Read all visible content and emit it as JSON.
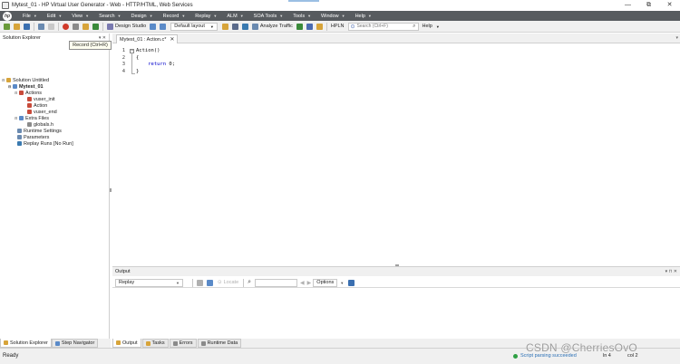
{
  "window": {
    "title": "Mytest_01 - HP Virtual User Generator - Web - HTTP/HTML, Web Services",
    "controls": [
      "—",
      "⧉",
      "✕"
    ]
  },
  "menu": {
    "logo": "hp",
    "items": [
      {
        "label": "File"
      },
      {
        "label": "Edit"
      },
      {
        "label": "View"
      },
      {
        "label": "Search"
      },
      {
        "label": "Design"
      },
      {
        "label": "Record"
      },
      {
        "label": "Replay"
      },
      {
        "label": "ALM"
      },
      {
        "label": "SOA Tools"
      },
      {
        "label": "Tools"
      },
      {
        "label": "Window"
      },
      {
        "label": "Help"
      }
    ]
  },
  "toolbar": {
    "design_studio": "Design Studio",
    "layout": "Default layout",
    "analyze_traffic": "Analyze Traffic",
    "hpln": "HPLN",
    "search_placeholder": "Search (Ctrl+F)",
    "help": "Help"
  },
  "explorer": {
    "title": "Solution Explorer",
    "tooltip": "Record (Ctrl+R)",
    "tree": [
      {
        "label": "Solution Untitled"
      },
      {
        "label": "Mytest_01"
      },
      {
        "label": "Actions"
      },
      {
        "label": "vuser_init"
      },
      {
        "label": "Action"
      },
      {
        "label": "vuser_end"
      },
      {
        "label": "Extra Files"
      },
      {
        "label": "globals.h"
      },
      {
        "label": "Runtime Settings"
      },
      {
        "label": "Parameters"
      },
      {
        "label": "Replay Runs [No Run]"
      }
    ],
    "tabs": [
      {
        "label": "Solution Explorer"
      },
      {
        "label": "Step Navigator"
      }
    ]
  },
  "editor": {
    "tab_label": "Mytest_01 : Action.c*",
    "line_numbers": [
      "1",
      "2",
      "3",
      "4"
    ],
    "code": {
      "l1": "Action()",
      "l2": "{",
      "l3_kw": "return",
      "l3_rest": " 0;",
      "l4": "}"
    }
  },
  "output": {
    "title": "Output",
    "source": "Replay",
    "locate": "Locate",
    "options": "Options"
  },
  "bottom_tabs": [
    {
      "label": "Output"
    },
    {
      "label": "Tasks"
    },
    {
      "label": "Errors"
    },
    {
      "label": "Runtime Data"
    }
  ],
  "status": {
    "ready": "Ready",
    "message": "Script parsing succeeded",
    "ln": "ln 4",
    "col": "col 2"
  },
  "watermark": "CSDN @CherriesOvO",
  "colors": {
    "menubar": "#575b5f",
    "status_message": "#2a6fb5",
    "keyword": "#0000cc"
  }
}
